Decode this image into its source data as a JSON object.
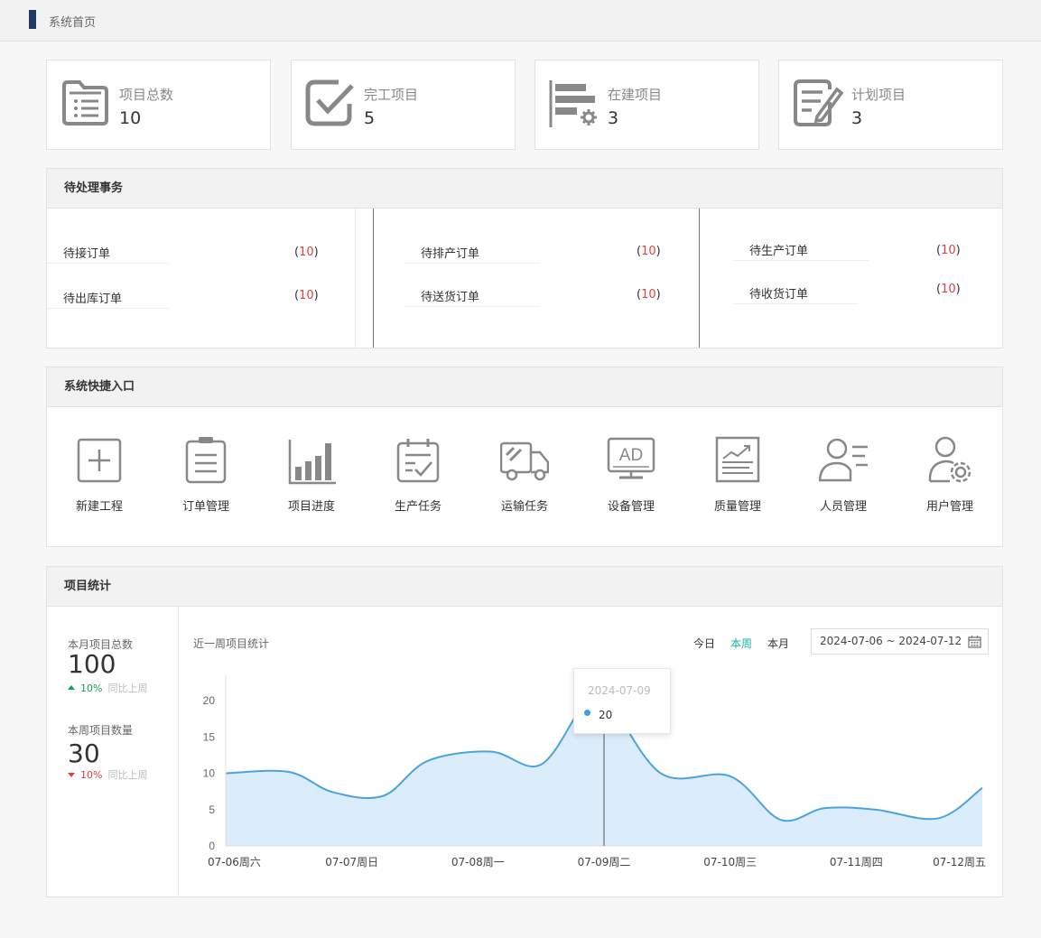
{
  "breadcrumb": {
    "title": "系统首页"
  },
  "stat_cards": [
    {
      "label": "项目总数",
      "value": "10",
      "icon": "folder-list-icon"
    },
    {
      "label": "完工项目",
      "value": "5",
      "icon": "checkbox-icon"
    },
    {
      "label": "在建项目",
      "value": "3",
      "icon": "bars-gear-icon"
    },
    {
      "label": "计划项目",
      "value": "3",
      "icon": "document-edit-icon"
    }
  ],
  "pending": {
    "title": "待处理事务",
    "items": [
      {
        "name": "待接订单",
        "count": "10"
      },
      {
        "name": "待出库订单",
        "count": "10"
      },
      {
        "name": "待排产订单",
        "count": "10"
      },
      {
        "name": "待送货订单",
        "count": "10"
      },
      {
        "name": "待生产订单",
        "count": "10"
      },
      {
        "name": "待收货订单",
        "count": "10"
      }
    ]
  },
  "shortcuts": {
    "title": "系统快捷入口",
    "items": [
      {
        "label": "新建工程",
        "icon": "plus-square-icon"
      },
      {
        "label": "订单管理",
        "icon": "clipboard-icon"
      },
      {
        "label": "项目进度",
        "icon": "bar-chart-icon"
      },
      {
        "label": "生产任务",
        "icon": "calendar-check-icon"
      },
      {
        "label": "运输任务",
        "icon": "truck-icon"
      },
      {
        "label": "设备管理",
        "icon": "monitor-ad-icon"
      },
      {
        "label": "质量管理",
        "icon": "report-chart-icon"
      },
      {
        "label": "人员管理",
        "icon": "person-list-icon"
      },
      {
        "label": "用户管理",
        "icon": "user-gear-icon"
      }
    ]
  },
  "stats": {
    "title": "项目统计",
    "month_total": {
      "label": "本月项目总数",
      "value": "100",
      "pct": "10%",
      "cmp": "同比上周",
      "trend": "up"
    },
    "week_total": {
      "label": "本周项目数量",
      "value": "30",
      "pct": "10%",
      "cmp": "同比上周",
      "trend": "down"
    },
    "chart_title": "近一周项目统计",
    "range_tabs": [
      {
        "label": "今日",
        "active": false
      },
      {
        "label": "本周",
        "active": true
      },
      {
        "label": "本月",
        "active": false
      }
    ],
    "date_range": "2024-07-06 ~ 2024-07-12",
    "tooltip": {
      "date": "2024-07-09",
      "value": "20"
    }
  },
  "chart_data": {
    "type": "area",
    "x": [
      "07-06周六",
      "07-07周日",
      "07-08周一",
      "07-09周二",
      "07-10周三",
      "07-11周四",
      "07-12周五"
    ],
    "samples_x": [
      0,
      0.5,
      0.85,
      1.25,
      1.6,
      2.1,
      2.5,
      2.85,
      3.0,
      3.45,
      4.0,
      4.4,
      4.75,
      5.15,
      5.65,
      6.0
    ],
    "samples_y": [
      10,
      10.2,
      7.4,
      6.9,
      11.7,
      13.0,
      11.2,
      19.9,
      21.0,
      10.0,
      9.6,
      3.6,
      5.2,
      5.0,
      3.8,
      8.0
    ],
    "yticks": [
      0,
      5,
      10,
      15,
      20
    ],
    "ylim": [
      0,
      23.5
    ],
    "xlabel": "",
    "ylabel": "",
    "grid": false,
    "color": "#4aa3df",
    "fill": "#dbedfa"
  }
}
